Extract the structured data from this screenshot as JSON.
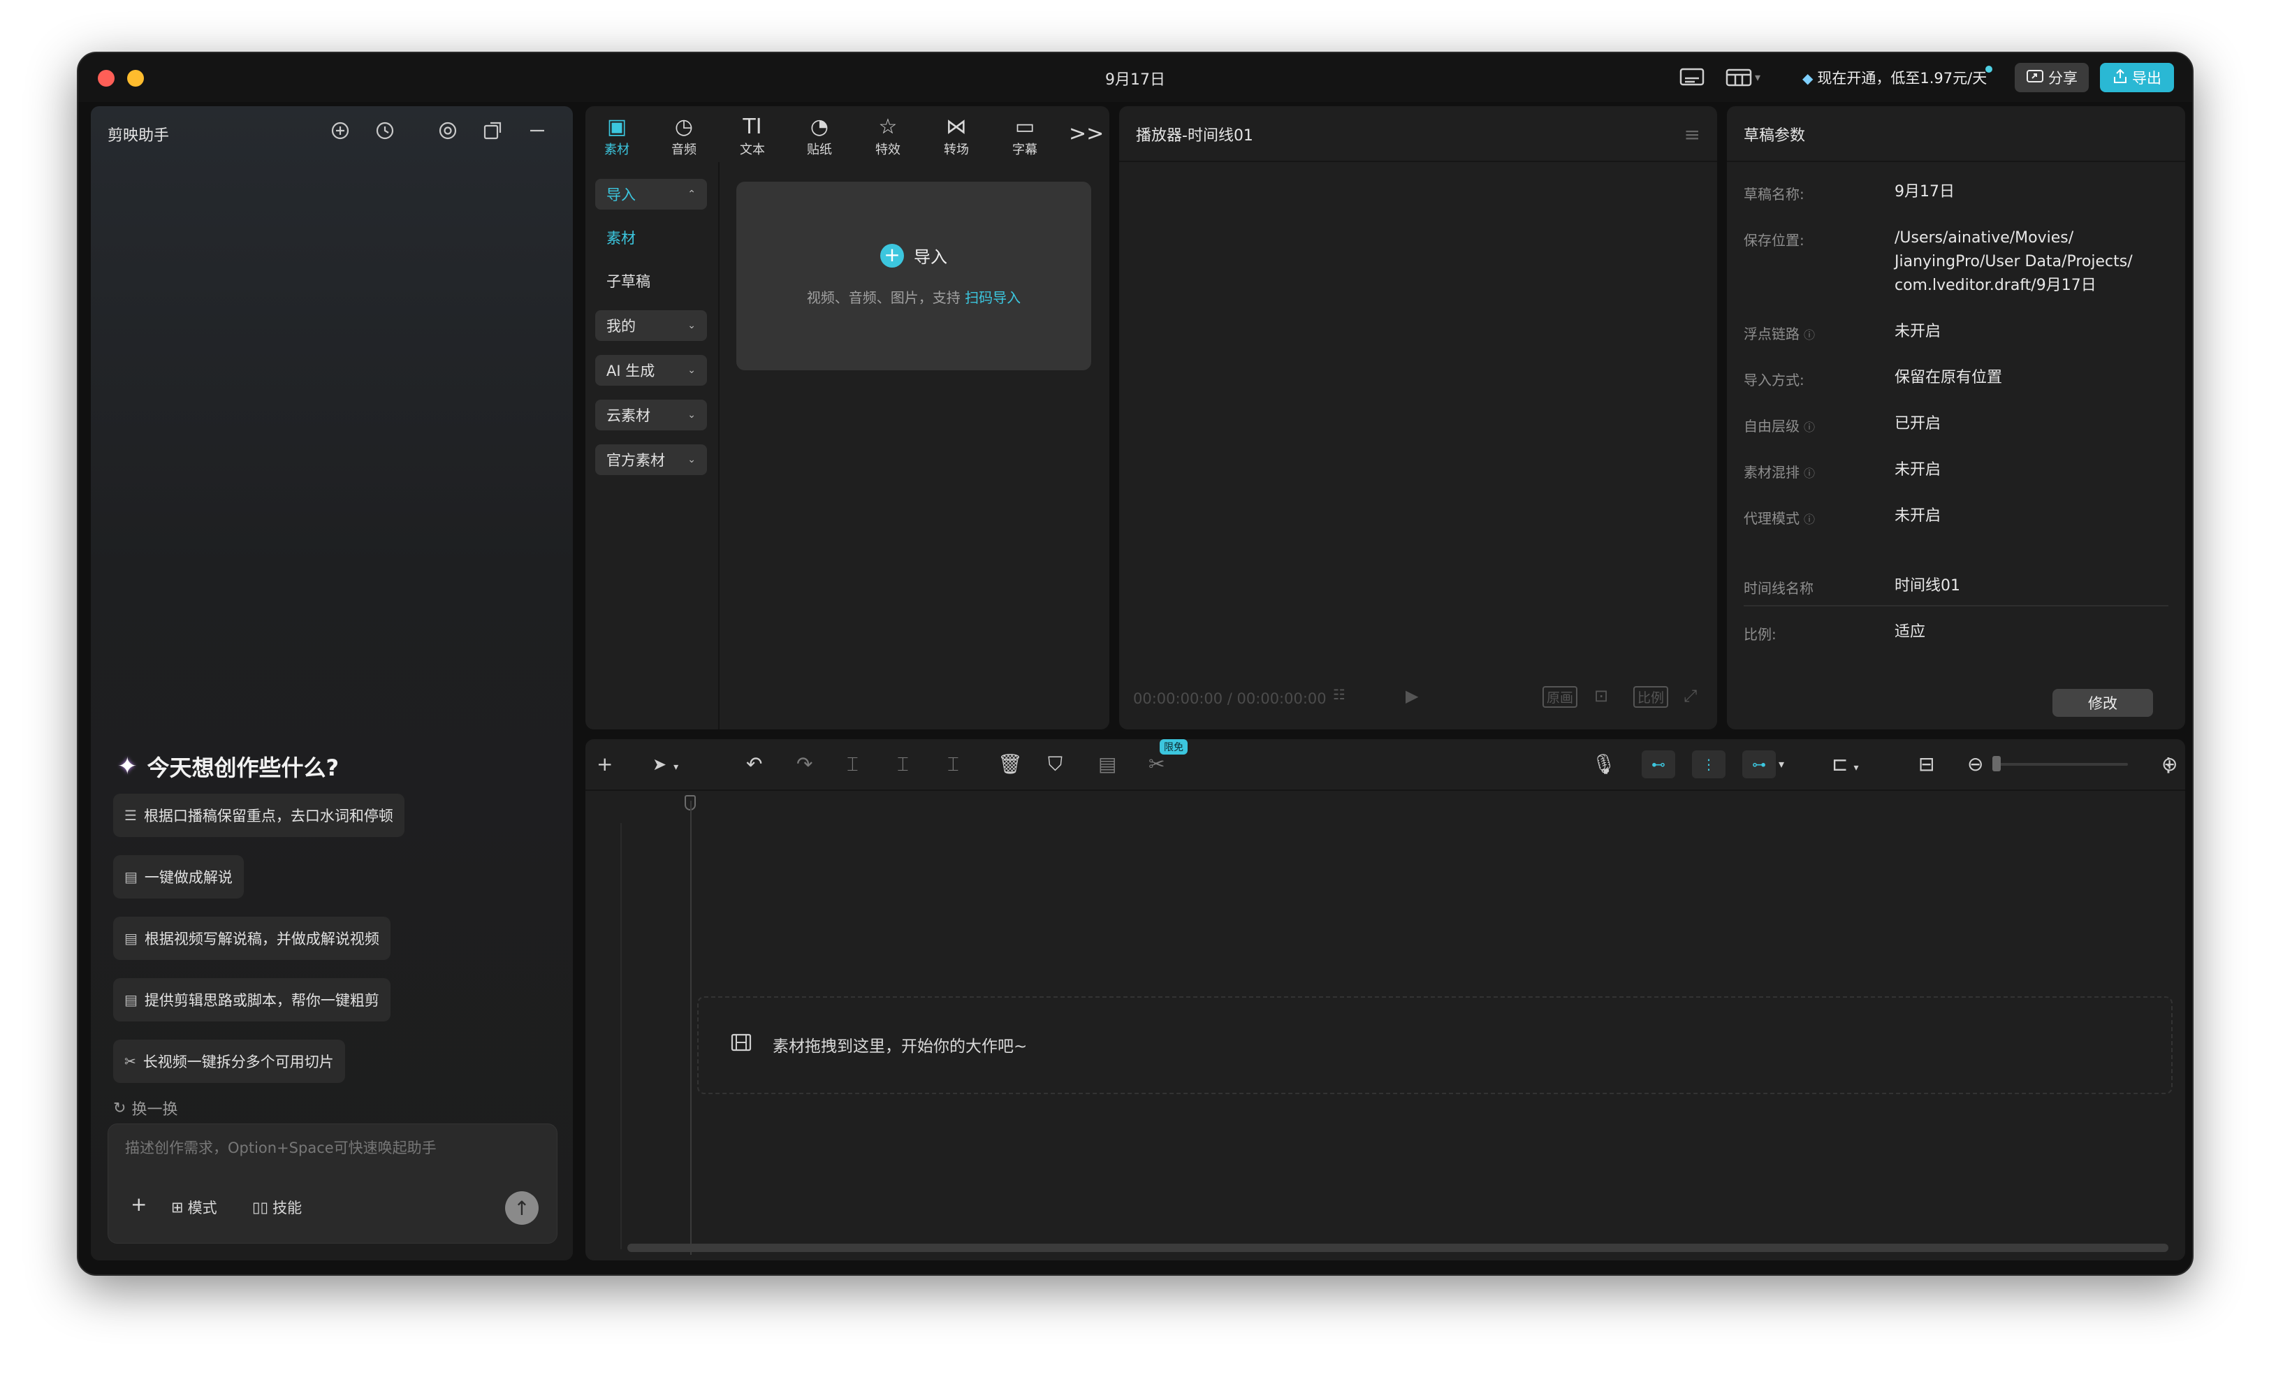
{
  "window": {
    "title": "9月17日"
  },
  "titlebar": {
    "promo_text": "现在开通，低至1.97元/天",
    "share_label": "分享",
    "export_label": "导出"
  },
  "assistant": {
    "title": "剪映助手",
    "prompt": "今天想创作些什么?",
    "suggestions": [
      "根据口播稿保留重点，去口水词和停顿",
      "一键做成解说",
      "根据视频写解说稿，并做成解说视频",
      "提供剪辑思路或脚本，帮你一键粗剪",
      "长视频一键拆分多个可用切片"
    ],
    "refresh_label": "换一换",
    "input_placeholder": "描述创作需求，Option+Space可快速唤起助手",
    "mode_label": "模式",
    "skill_label": "技能"
  },
  "media": {
    "tabs": [
      "素材",
      "音频",
      "文本",
      "贴纸",
      "特效",
      "转场",
      "字幕"
    ],
    "sidebar": {
      "import": "导入",
      "material": "素材",
      "sub_draft": "子草稿",
      "mine": "我的",
      "ai_gen": "AI 生成",
      "cloud": "云素材",
      "official": "官方素材"
    },
    "import_card": {
      "title": "导入",
      "subtitle": "视频、音频、图片，支持",
      "link": "扫码导入"
    }
  },
  "player": {
    "title": "播放器-时间线01",
    "timecode": "00:00:00:00 / 00:00:00:00",
    "btn_original": "原画",
    "btn_ratio": "比例"
  },
  "params": {
    "title": "草稿参数",
    "rows": [
      {
        "label": "草稿名称:",
        "value": "9月17日"
      },
      {
        "label": "保存位置:",
        "value": "/Users/ainative/Movies/\nJianyingPro/User Data/Projects/\ncom.lveditor.draft/9月17日"
      },
      {
        "label": "浮点链路",
        "value": "未开启"
      },
      {
        "label": "导入方式:",
        "value": "保留在原有位置"
      },
      {
        "label": "自由层级",
        "value": "已开启"
      },
      {
        "label": "素材混排",
        "value": "未开启"
      },
      {
        "label": "代理模式",
        "value": "未开启"
      },
      {
        "label": "时间线名称",
        "value": "时间线01"
      },
      {
        "label": "比例:",
        "value": "适应"
      }
    ],
    "modify_label": "修改"
  },
  "timeline": {
    "badge_free": "限免",
    "drop_text": "素材拖拽到这里，开始你的大作吧~"
  }
}
